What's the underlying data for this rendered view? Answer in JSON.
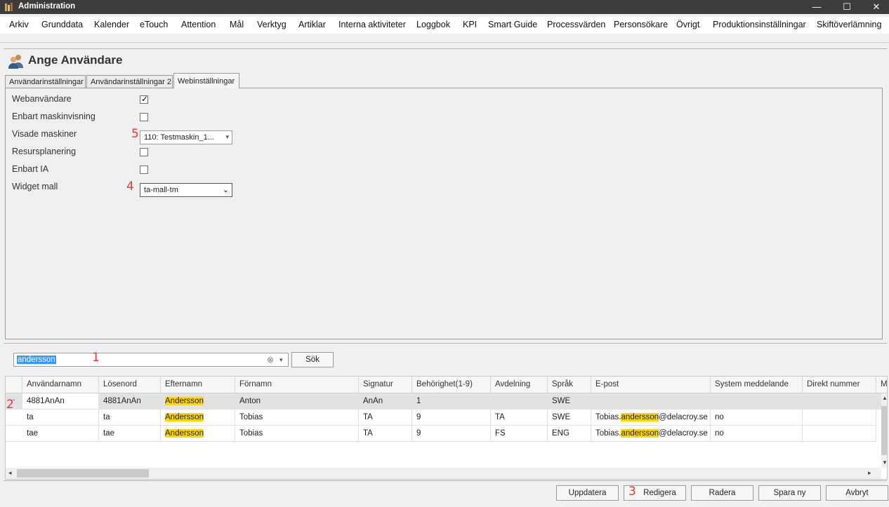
{
  "window": {
    "title": "Administration",
    "minimize": "—",
    "maximize": "☐",
    "close": "✕"
  },
  "menu": [
    "Arkiv",
    "Grunddata",
    "Kalender",
    "eTouch",
    "Attention",
    "Mål",
    "Verktyg",
    "Artiklar",
    "Interna aktiviteter",
    "Loggbok",
    "KPI",
    "Smart Guide",
    "Processvärden",
    "Personsökare",
    "Övrigt",
    "Produktionsinställningar",
    "Skiftöverlämning"
  ],
  "page": {
    "title": "Ange Användare"
  },
  "tabs": [
    "Användarinställningar",
    "Användarinställningar 2",
    "Webinställningar"
  ],
  "active_tab": "Webinställningar",
  "form": {
    "webanvandare": {
      "label": "Webanvändare",
      "checked": true
    },
    "enbart_maskinvisning": {
      "label": "Enbart maskinvisning",
      "checked": false
    },
    "visade_maskiner": {
      "label": "Visade maskiner",
      "value": "110: Testmaskin_1..."
    },
    "resursplanering": {
      "label": "Resursplanering",
      "checked": false
    },
    "enbart_ia": {
      "label": "Enbart IA",
      "checked": false
    },
    "widget_mall": {
      "label": "Widget mall",
      "value": "ta-mall-tm"
    }
  },
  "annotations": {
    "a1": "1",
    "a2": "2",
    "a3": "3",
    "a4": "4",
    "a5": "5"
  },
  "search": {
    "value": "andersson",
    "button": "Sök",
    "clear_icon": "⊗",
    "dropdown_icon": "▾"
  },
  "grid": {
    "columns": [
      "Användarnamn",
      "Lösenord",
      "Efternamn",
      "Förnamn",
      "Signatur",
      "Behörighet(1-9)",
      "Avdelning",
      "Språk",
      "E-post",
      "System meddelande",
      "Direkt nummer",
      "Mo"
    ],
    "rows": [
      {
        "anvandarnamn": "4881AnAn",
        "losenord": "4881AnAn",
        "efternamn": "Andersson",
        "fornamn": "Anton",
        "signatur": "AnAn",
        "behorighet": "1",
        "avdelning": "",
        "sprak": "SWE",
        "epost_pre": "",
        "epost_hl": "",
        "epost_post": "",
        "system": "",
        "direkt": ""
      },
      {
        "anvandarnamn": "ta",
        "losenord": "ta",
        "efternamn": "Andersson",
        "fornamn": "Tobias",
        "signatur": "TA",
        "behorighet": "9",
        "avdelning": "TA",
        "sprak": "SWE",
        "epost_pre": "Tobias.",
        "epost_hl": "andersson",
        "epost_post": "@delacroy.se",
        "system": "no",
        "direkt": ""
      },
      {
        "anvandarnamn": "tae",
        "losenord": "tae",
        "efternamn": "Andersson",
        "fornamn": "Tobias",
        "signatur": "TA",
        "behorighet": "9",
        "avdelning": "FS",
        "sprak": "ENG",
        "epost_pre": "Tobias.",
        "epost_hl": "andersson",
        "epost_post": "@delacroy.se",
        "system": "no",
        "direkt": ""
      }
    ],
    "selected_row": 0
  },
  "buttons": {
    "uppdatera": "Uppdatera",
    "redigera": "Redigera",
    "radera": "Radera",
    "spara_ny": "Spara ny",
    "avbryt": "Avbryt"
  },
  "colors": {
    "highlight": "#ffd700",
    "selection": "#3399ff",
    "annotation": "#e53935",
    "titlebar": "#3c3c3c"
  }
}
